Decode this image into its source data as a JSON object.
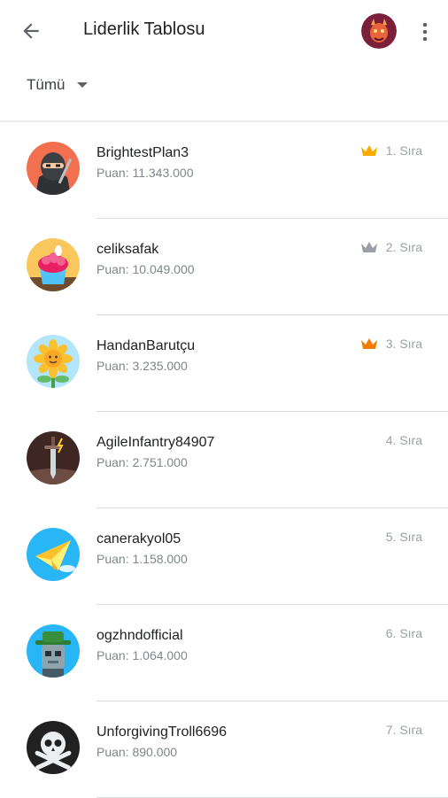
{
  "header": {
    "title": "Liderlik Tablosu",
    "back_icon": "arrow-back-icon",
    "more_icon": "more-vert-icon",
    "profile_icon": "dragon-avatar-icon"
  },
  "filter": {
    "label": "Tümü",
    "icon": "dropdown-caret-icon"
  },
  "colors": {
    "gold": "#f9ab00",
    "silver": "#9aa0a6",
    "bronze": "#f57c00",
    "divider": "#dadce0",
    "secondary_text": "#80868b"
  },
  "players": [
    {
      "name": "BrightestPlan3",
      "score": "Puan: 11.343.000",
      "rank": "1. Sıra",
      "crown": "gold",
      "avatar": "ninja-avatar"
    },
    {
      "name": "celiksafak",
      "score": "Puan: 10.049.000",
      "rank": "2. Sıra",
      "crown": "silver",
      "avatar": "cupcake-avatar"
    },
    {
      "name": "HandanBarutçu",
      "score": "Puan: 3.235.000",
      "rank": "3. Sıra",
      "crown": "bronze",
      "avatar": "sunflower-avatar"
    },
    {
      "name": "AgileInfantry84907",
      "score": "Puan: 2.751.000",
      "rank": "4. Sıra",
      "crown": null,
      "avatar": "sword-avatar"
    },
    {
      "name": "canerakyol05",
      "score": "Puan: 1.158.000",
      "rank": "5. Sıra",
      "crown": null,
      "avatar": "paper-plane-avatar"
    },
    {
      "name": "ogzhndofficial",
      "score": "Puan: 1.064.000",
      "rank": "6. Sıra",
      "crown": null,
      "avatar": "robot-hat-avatar"
    },
    {
      "name": "UnforgivingTroll6696",
      "score": "Puan: 890.000",
      "rank": "7. Sıra",
      "crown": null,
      "avatar": "skull-avatar"
    }
  ]
}
